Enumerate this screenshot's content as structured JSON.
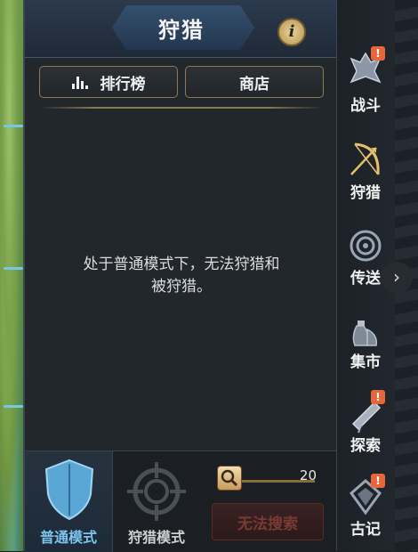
{
  "header": {
    "title": "狩猎",
    "info_icon": "info-icon"
  },
  "tabs": [
    {
      "label": "排行榜",
      "icon": "bar-chart-icon"
    },
    {
      "label": "商店"
    }
  ],
  "message": {
    "line1": "处于普通模式下，无法狩猎和",
    "line2": "被狩猎。"
  },
  "modes": [
    {
      "label": "普通模式",
      "icon": "shield-icon",
      "selected": true,
      "color": "#7cc4ef"
    },
    {
      "label": "狩猎模式",
      "icon": "crosshair-icon",
      "selected": false
    }
  ],
  "search": {
    "count": "20",
    "button_label": "无法搜索",
    "icon": "magnify-icon"
  },
  "right_nav": [
    {
      "label": "战斗",
      "icon": "battle-icon",
      "badge": "!"
    },
    {
      "label": "狩猎",
      "icon": "bow-icon",
      "badge": ""
    },
    {
      "label": "传送",
      "icon": "portal-icon",
      "badge": ""
    },
    {
      "label": "集市",
      "icon": "market-icon",
      "badge": ""
    },
    {
      "label": "探索",
      "icon": "telescope-icon",
      "badge": "!"
    },
    {
      "label": "古记",
      "icon": "ancient-record-icon",
      "badge": "!"
    }
  ],
  "colors": {
    "accent": "#7cc4ef",
    "badge": "#e8673a",
    "gold_border": "#8e7a52"
  }
}
